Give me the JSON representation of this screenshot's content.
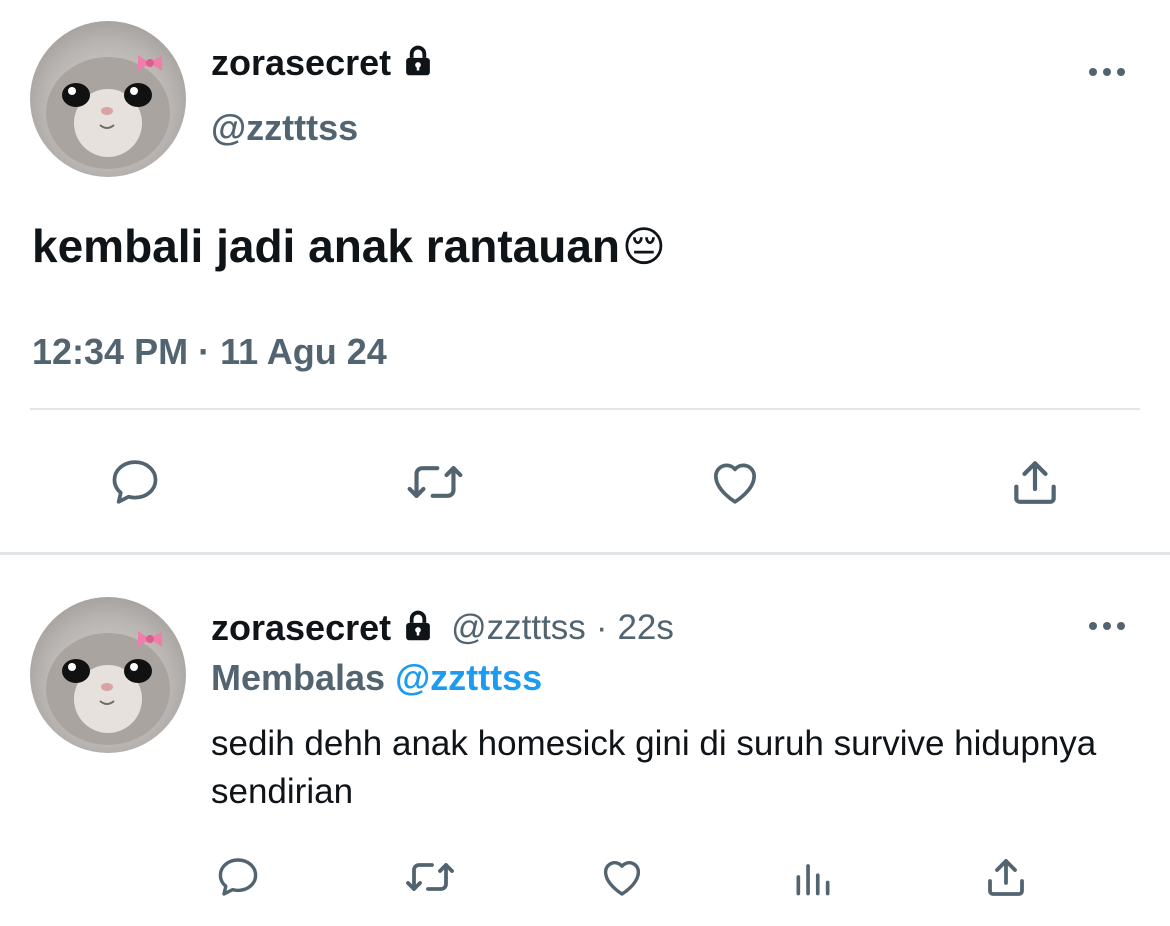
{
  "main_tweet": {
    "display_name": "zorasecret",
    "handle": "@zztttss",
    "text": "kembali jadi anak rantauan",
    "emoji": "😔",
    "timestamp": "12:34 PM · 11 Agu 24"
  },
  "reply": {
    "display_name": "zorasecret",
    "handle": "@zztttss",
    "separator": "·",
    "time_ago": "22s",
    "replying_label": "Membalas",
    "replying_to": "@zztttss",
    "text": "sedih dehh anak homesick gini di suruh survive hidupnya sendirian"
  },
  "icons": {
    "lock": "lock-icon",
    "more": "more-horizontal-icon",
    "reply": "comment-bubble-icon",
    "retweet": "retweet-icon",
    "like": "heart-icon",
    "share": "share-upload-icon",
    "analytics": "bar-chart-icon"
  },
  "colors": {
    "text_primary": "#0f1419",
    "text_secondary": "#536471",
    "accent": "#1d9bf0",
    "divider": "#e1e6ea"
  }
}
